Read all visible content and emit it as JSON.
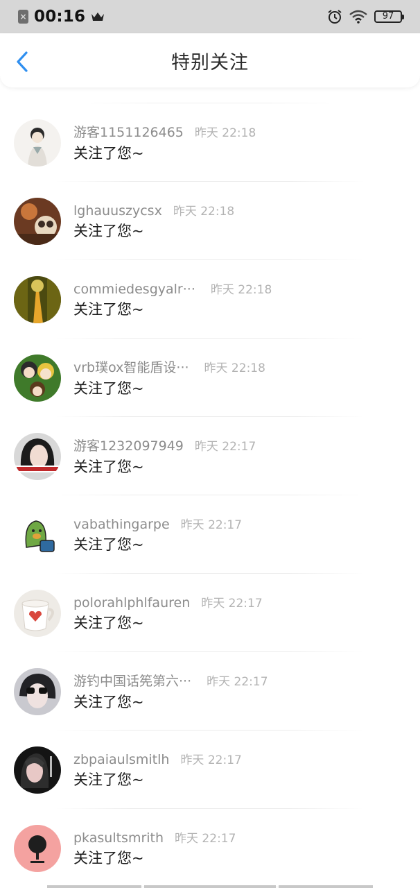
{
  "status_bar": {
    "time": "00:16",
    "battery": "97",
    "notification_icon": "app-notification-icon",
    "crown_icon": "crown-icon",
    "alarm_icon": "alarm-clock-icon",
    "wifi_icon": "wifi-icon"
  },
  "header": {
    "title": "特别关注",
    "back_icon": "chevron-left-icon",
    "accent_color": "#2f8ff0"
  },
  "items": [
    {
      "name": "游客1151126465",
      "truncated": false,
      "time": "昨天 22:18",
      "message": "关注了您~"
    },
    {
      "name": "lghauuszycsx",
      "truncated": false,
      "time": "昨天 22:18",
      "message": "关注了您~"
    },
    {
      "name": "commiedesgyalr",
      "truncated": true,
      "time": "昨天 22:18",
      "message": "关注了您~"
    },
    {
      "name": "vrb璞ox智能盾设",
      "truncated": true,
      "time": "昨天 22:18",
      "message": "关注了您~"
    },
    {
      "name": "游客1232097949",
      "truncated": false,
      "time": "昨天 22:17",
      "message": "关注了您~"
    },
    {
      "name": "vabathingarpe",
      "truncated": false,
      "time": "昨天 22:17",
      "message": "关注了您~"
    },
    {
      "name": "polorahlphlfauren",
      "truncated": false,
      "time": "昨天 22:17",
      "message": "关注了您~"
    },
    {
      "name": "游钓中国话筅第六",
      "truncated": true,
      "time": "昨天 22:17",
      "message": "关注了您~"
    },
    {
      "name": "zbpaiaulsmitlh",
      "truncated": false,
      "time": "昨天 22:17",
      "message": "关注了您~"
    },
    {
      "name": "pkasultsmrith",
      "truncated": false,
      "time": "昨天 22:17",
      "message": "关注了您~"
    }
  ],
  "ellipsis": "···"
}
